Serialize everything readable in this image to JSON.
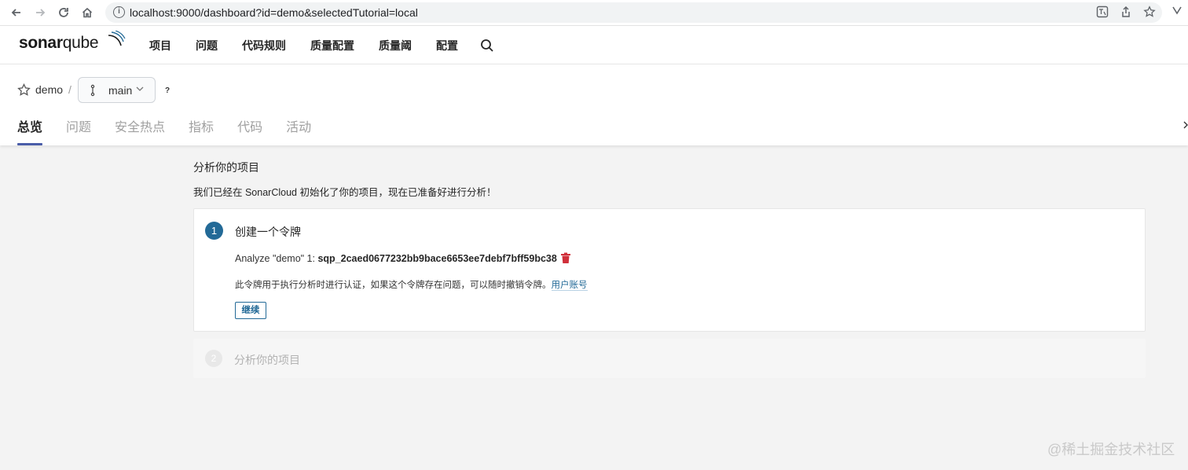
{
  "browser": {
    "url": "localhost:9000/dashboard?id=demo&selectedTutorial=local",
    "icons": [
      "back-icon",
      "forward-icon",
      "reload-icon",
      "home-icon",
      "info-icon",
      "translate-icon",
      "share-icon",
      "bookmark-star-icon"
    ]
  },
  "header": {
    "logo": "sonarqube",
    "menu": [
      "项目",
      "问题",
      "代码规则",
      "质量配置",
      "质量阈",
      "配置"
    ]
  },
  "project": {
    "name": "demo",
    "separator": "/",
    "branch": "main",
    "help": "?",
    "tabs": [
      "总览",
      "问题",
      "安全热点",
      "指标",
      "代码",
      "活动"
    ],
    "active_tab": "总览"
  },
  "main": {
    "title": "分析你的项目",
    "description": "我们已经在 SonarCloud 初始化了你的项目，现在已准备好进行分析！"
  },
  "step1": {
    "number": "1",
    "title": "创建一个令牌",
    "token_label": "Analyze \"demo\" 1: ",
    "token_value": "sqp_2caed0677232bb9bace6653ee7debf7bff59bc38",
    "note": "此令牌用于执行分析时进行认证，如果这个令牌存在问题，可以随时撤销令牌。",
    "link": "用户账号",
    "continue": "继续"
  },
  "step2": {
    "number": "2",
    "title": "分析你的项目"
  },
  "watermark": "@稀土掘金技术社区",
  "colors": {
    "accent": "#236a97",
    "tab_underline": "#4a5da8",
    "delete": "#d02f3a"
  }
}
